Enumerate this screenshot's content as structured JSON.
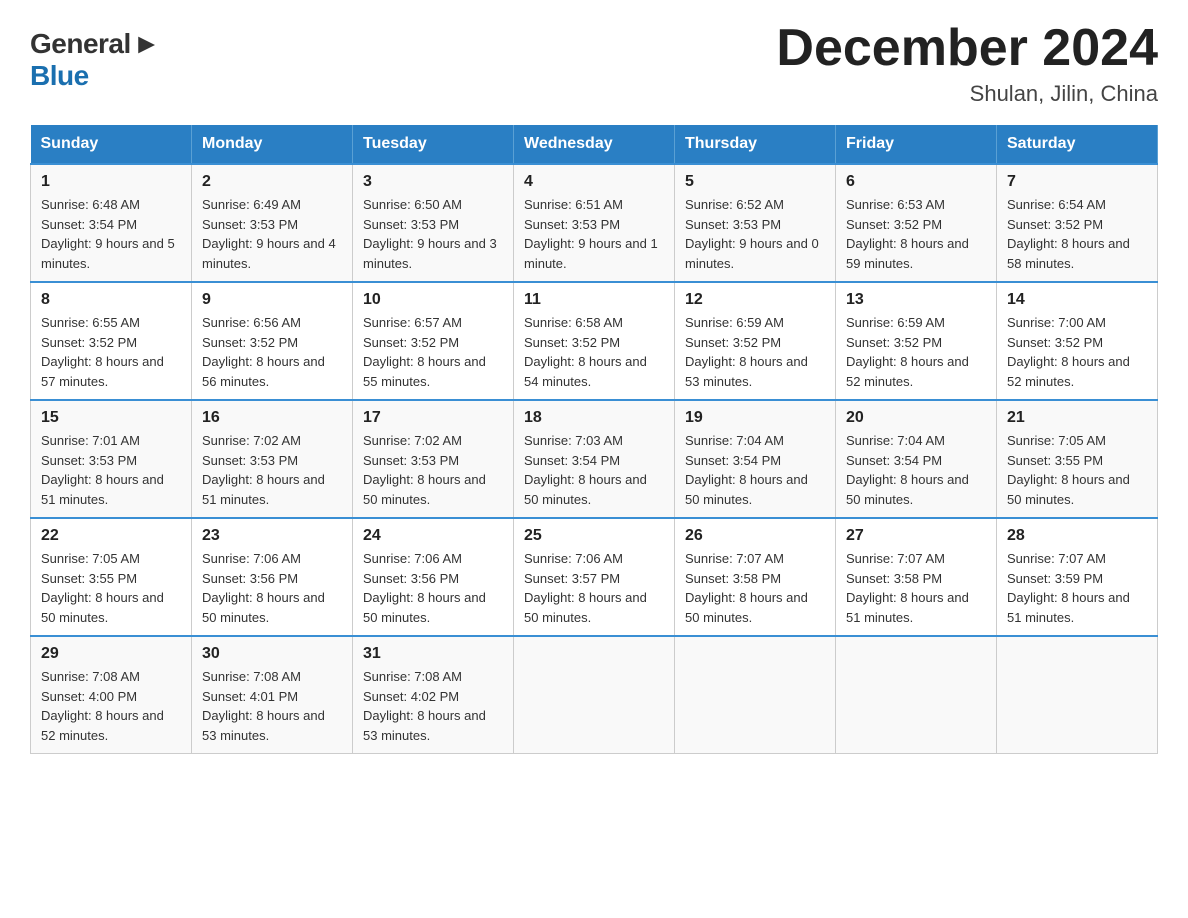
{
  "header": {
    "logo_general": "General",
    "logo_blue": "Blue",
    "month_title": "December 2024",
    "subtitle": "Shulan, Jilin, China"
  },
  "days_of_week": [
    "Sunday",
    "Monday",
    "Tuesday",
    "Wednesday",
    "Thursday",
    "Friday",
    "Saturday"
  ],
  "weeks": [
    [
      {
        "day": "1",
        "sunrise": "6:48 AM",
        "sunset": "3:54 PM",
        "daylight": "9 hours and 5 minutes."
      },
      {
        "day": "2",
        "sunrise": "6:49 AM",
        "sunset": "3:53 PM",
        "daylight": "9 hours and 4 minutes."
      },
      {
        "day": "3",
        "sunrise": "6:50 AM",
        "sunset": "3:53 PM",
        "daylight": "9 hours and 3 minutes."
      },
      {
        "day": "4",
        "sunrise": "6:51 AM",
        "sunset": "3:53 PM",
        "daylight": "9 hours and 1 minute."
      },
      {
        "day": "5",
        "sunrise": "6:52 AM",
        "sunset": "3:53 PM",
        "daylight": "9 hours and 0 minutes."
      },
      {
        "day": "6",
        "sunrise": "6:53 AM",
        "sunset": "3:52 PM",
        "daylight": "8 hours and 59 minutes."
      },
      {
        "day": "7",
        "sunrise": "6:54 AM",
        "sunset": "3:52 PM",
        "daylight": "8 hours and 58 minutes."
      }
    ],
    [
      {
        "day": "8",
        "sunrise": "6:55 AM",
        "sunset": "3:52 PM",
        "daylight": "8 hours and 57 minutes."
      },
      {
        "day": "9",
        "sunrise": "6:56 AM",
        "sunset": "3:52 PM",
        "daylight": "8 hours and 56 minutes."
      },
      {
        "day": "10",
        "sunrise": "6:57 AM",
        "sunset": "3:52 PM",
        "daylight": "8 hours and 55 minutes."
      },
      {
        "day": "11",
        "sunrise": "6:58 AM",
        "sunset": "3:52 PM",
        "daylight": "8 hours and 54 minutes."
      },
      {
        "day": "12",
        "sunrise": "6:59 AM",
        "sunset": "3:52 PM",
        "daylight": "8 hours and 53 minutes."
      },
      {
        "day": "13",
        "sunrise": "6:59 AM",
        "sunset": "3:52 PM",
        "daylight": "8 hours and 52 minutes."
      },
      {
        "day": "14",
        "sunrise": "7:00 AM",
        "sunset": "3:52 PM",
        "daylight": "8 hours and 52 minutes."
      }
    ],
    [
      {
        "day": "15",
        "sunrise": "7:01 AM",
        "sunset": "3:53 PM",
        "daylight": "8 hours and 51 minutes."
      },
      {
        "day": "16",
        "sunrise": "7:02 AM",
        "sunset": "3:53 PM",
        "daylight": "8 hours and 51 minutes."
      },
      {
        "day": "17",
        "sunrise": "7:02 AM",
        "sunset": "3:53 PM",
        "daylight": "8 hours and 50 minutes."
      },
      {
        "day": "18",
        "sunrise": "7:03 AM",
        "sunset": "3:54 PM",
        "daylight": "8 hours and 50 minutes."
      },
      {
        "day": "19",
        "sunrise": "7:04 AM",
        "sunset": "3:54 PM",
        "daylight": "8 hours and 50 minutes."
      },
      {
        "day": "20",
        "sunrise": "7:04 AM",
        "sunset": "3:54 PM",
        "daylight": "8 hours and 50 minutes."
      },
      {
        "day": "21",
        "sunrise": "7:05 AM",
        "sunset": "3:55 PM",
        "daylight": "8 hours and 50 minutes."
      }
    ],
    [
      {
        "day": "22",
        "sunrise": "7:05 AM",
        "sunset": "3:55 PM",
        "daylight": "8 hours and 50 minutes."
      },
      {
        "day": "23",
        "sunrise": "7:06 AM",
        "sunset": "3:56 PM",
        "daylight": "8 hours and 50 minutes."
      },
      {
        "day": "24",
        "sunrise": "7:06 AM",
        "sunset": "3:56 PM",
        "daylight": "8 hours and 50 minutes."
      },
      {
        "day": "25",
        "sunrise": "7:06 AM",
        "sunset": "3:57 PM",
        "daylight": "8 hours and 50 minutes."
      },
      {
        "day": "26",
        "sunrise": "7:07 AM",
        "sunset": "3:58 PM",
        "daylight": "8 hours and 50 minutes."
      },
      {
        "day": "27",
        "sunrise": "7:07 AM",
        "sunset": "3:58 PM",
        "daylight": "8 hours and 51 minutes."
      },
      {
        "day": "28",
        "sunrise": "7:07 AM",
        "sunset": "3:59 PM",
        "daylight": "8 hours and 51 minutes."
      }
    ],
    [
      {
        "day": "29",
        "sunrise": "7:08 AM",
        "sunset": "4:00 PM",
        "daylight": "8 hours and 52 minutes."
      },
      {
        "day": "30",
        "sunrise": "7:08 AM",
        "sunset": "4:01 PM",
        "daylight": "8 hours and 53 minutes."
      },
      {
        "day": "31",
        "sunrise": "7:08 AM",
        "sunset": "4:02 PM",
        "daylight": "8 hours and 53 minutes."
      },
      null,
      null,
      null,
      null
    ]
  ]
}
